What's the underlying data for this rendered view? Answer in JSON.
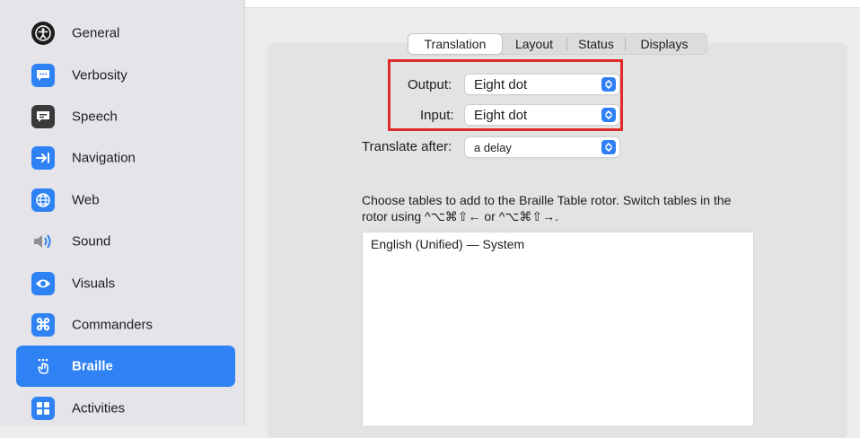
{
  "sidebar": {
    "items": [
      {
        "label": "General",
        "icon": "accessibility-icon",
        "color": "#1d1d1f"
      },
      {
        "label": "Verbosity",
        "icon": "speech-bubble-icon",
        "color": "#2f82f4"
      },
      {
        "label": "Speech",
        "icon": "speech-bubble-dark-icon",
        "color": "#3a3a3c"
      },
      {
        "label": "Navigation",
        "icon": "arrow-to-line-icon",
        "color": "#2f82f4"
      },
      {
        "label": "Web",
        "icon": "globe-icon",
        "color": "#2f82f4"
      },
      {
        "label": "Sound",
        "icon": "speaker-icon",
        "color": "#8e8e93"
      },
      {
        "label": "Visuals",
        "icon": "eye-icon",
        "color": "#2f82f4"
      },
      {
        "label": "Commanders",
        "icon": "command-key-icon",
        "color": "#2f82f4"
      },
      {
        "label": "Braille",
        "icon": "braille-hand-icon",
        "color": "#2f82f4",
        "selected": true
      },
      {
        "label": "Activities",
        "icon": "activities-icon",
        "color": "#2f82f4"
      }
    ]
  },
  "tabs": [
    "Translation",
    "Layout",
    "Status",
    "Displays"
  ],
  "active_tab": "Translation",
  "output": {
    "label": "Output:",
    "value": "Eight dot"
  },
  "input": {
    "label": "Input:",
    "value": "Eight dot"
  },
  "translate_after": {
    "label": "Translate after:",
    "value": "a delay"
  },
  "description": "Choose tables to add to the Braille Table rotor. Switch tables in the rotor using ^⌥⌘⇧← or ^⌥⌘⇧→.",
  "tables": [
    "English (Unified) — System"
  ],
  "colors": {
    "accent": "#2f82f4",
    "highlight": "#e02b2b"
  }
}
